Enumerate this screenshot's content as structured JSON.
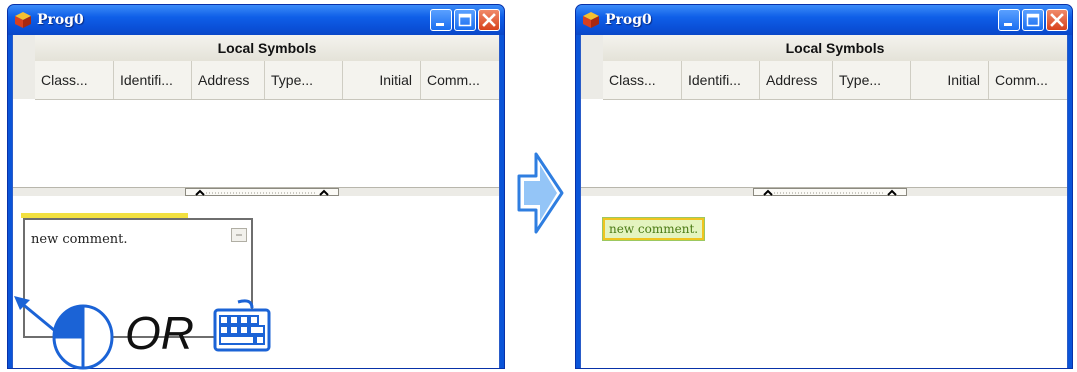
{
  "left_window": {
    "title": "Prog0",
    "table_header": "Local Symbols",
    "columns": [
      "Class...",
      "Identifi...",
      "Address",
      "Type...",
      "Initial",
      "Comm..."
    ],
    "comment_text": "new comment."
  },
  "right_window": {
    "title": "Prog0",
    "table_header": "Local Symbols",
    "columns": [
      "Class...",
      "Identifi...",
      "Address",
      "Type...",
      "Initial",
      "Comm..."
    ],
    "comment_text": "new comment."
  },
  "overlay": {
    "or_text": "OR",
    "icons": [
      "mouse-click-icon",
      "keyboard-icon",
      "pointer-arrow-icon"
    ]
  },
  "transition_arrow_icon": "right-arrow-icon",
  "colors": {
    "titlebar": "#0a54d8",
    "overlay_blue": "#1b63d6",
    "comment_border": "#f0c420",
    "comment_fill": "#e4f4c0"
  }
}
